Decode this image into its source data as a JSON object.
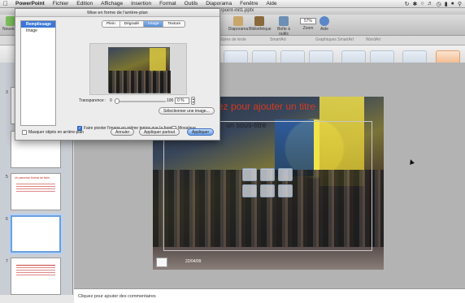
{
  "menubar": {
    "apple": "",
    "items": [
      "PowerPoint",
      "Fichier",
      "Edition",
      "Affichage",
      "Insertion",
      "Format",
      "Outils",
      "Diaporama",
      "Fenêtre",
      "Aide"
    ]
  },
  "window": {
    "filename": "erpoint-init1.pptx"
  },
  "toolbar": {
    "nouveau": "Nouveau",
    "diaporama": "Diaporama",
    "bibliotheque": "Bibliothèque",
    "boite": "Boîte à outils",
    "zoom_label": "Zoom",
    "zoom_value": "57%",
    "aide": "Aide"
  },
  "ribbon_tabs": [
    "Styles de texte",
    "SmartArt",
    "Graphiques SmartArt",
    "WordArt"
  ],
  "slides": {
    "numbers": [
      "3",
      "4",
      "5",
      "6",
      "7"
    ],
    "thumb5_title": "Un panneau format de fiche"
  },
  "main_slide": {
    "title": "ez pour ajouter un titre",
    "subtitle": "un sous-titre",
    "date": "22/04/09"
  },
  "notes": {
    "placeholder": "Cliquez pour ajouter des commentaires"
  },
  "dialog": {
    "title": "Mise en forme de l'arrière-plan",
    "categories": [
      "Remplissage",
      "Image"
    ],
    "tabs": [
      "Plein",
      "Dégradé",
      "Image",
      "Texture"
    ],
    "active_tab": "Image",
    "transparency_label": "Transparence :",
    "slider_min": "0",
    "slider_max": "100",
    "transparency_value": "0 %",
    "transparency_level": 0,
    "select_image": "Sélectionner une image...",
    "rotate_checkbox": "Faire pivoter l'image en même temps que la forme",
    "rotate_checked": true,
    "mosaic_checkbox": "Mosaïque",
    "mosaic_checked": false,
    "hide_bg_checkbox": "Masquer objets en arrière-plan",
    "hide_bg_checked": false,
    "cancel": "Annuler",
    "apply_all": "Appliquer partout",
    "apply": "Appliquer"
  }
}
